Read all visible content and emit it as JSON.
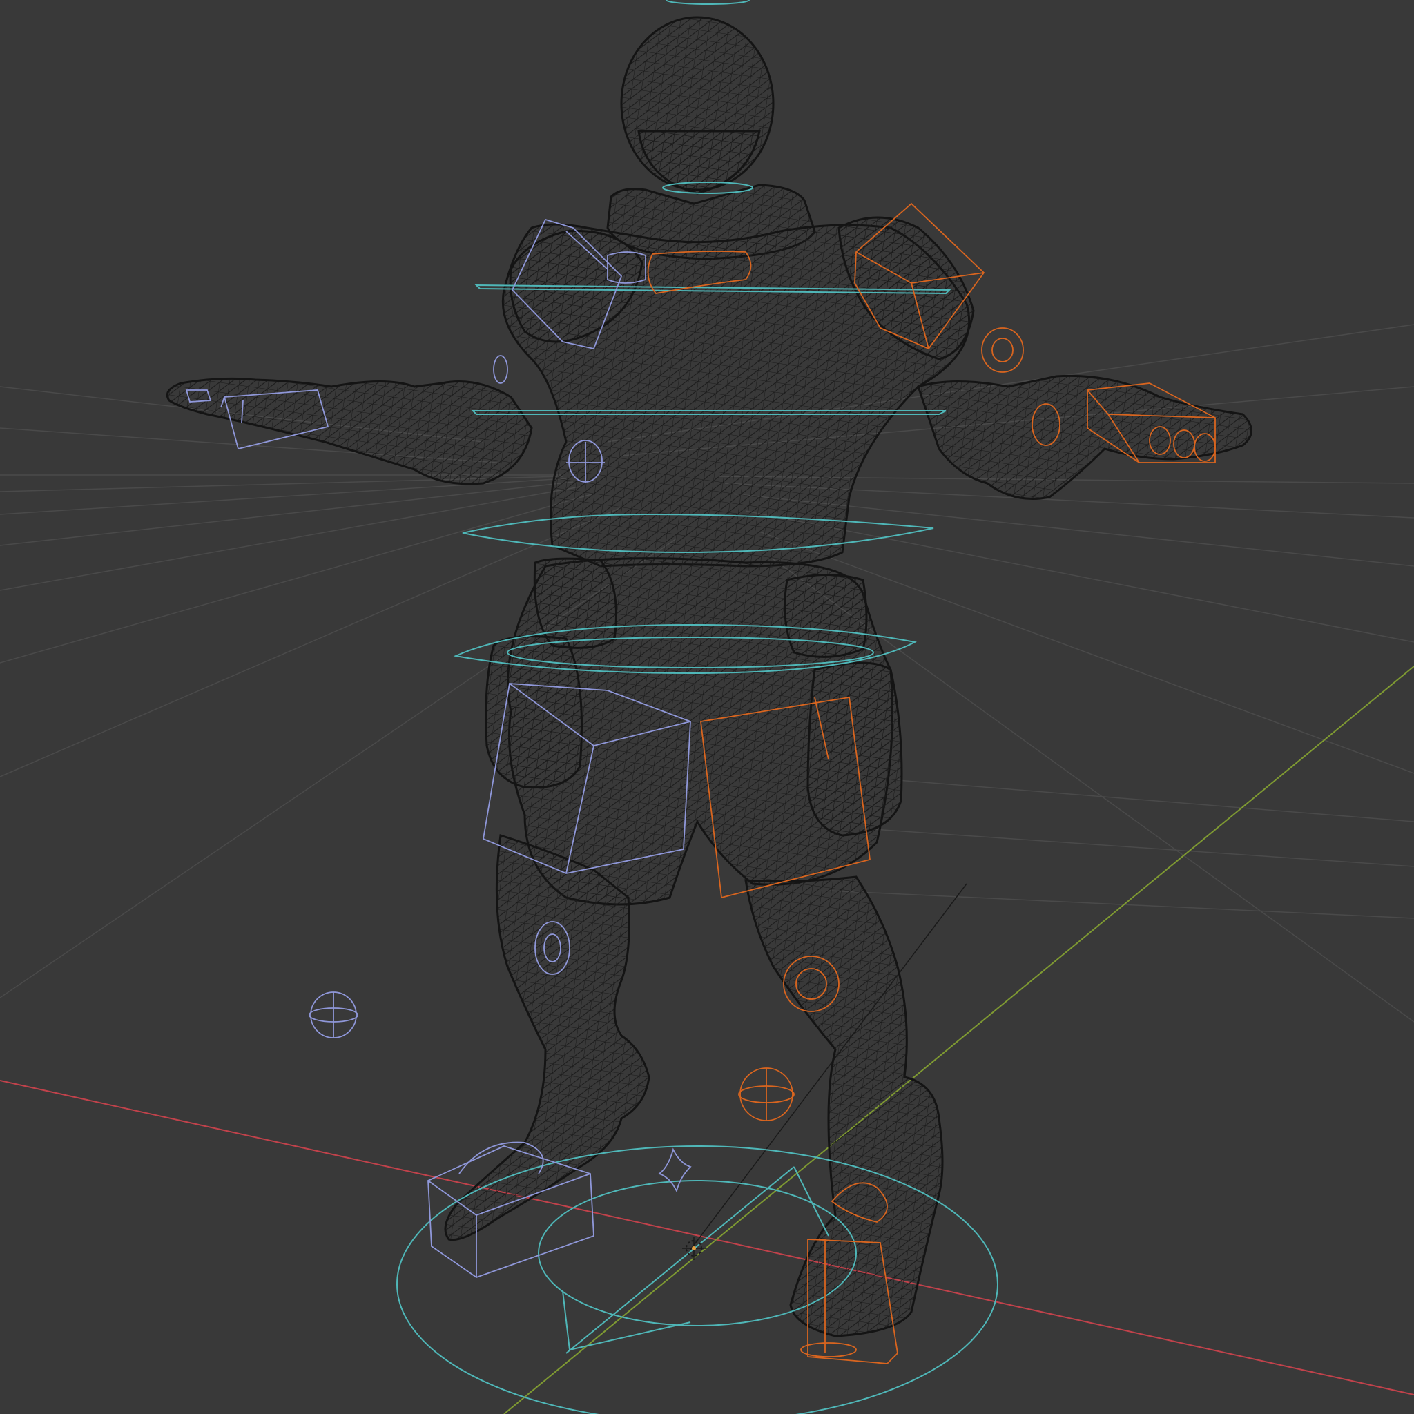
{
  "app": "3d-viewport",
  "viewport": {
    "shading": "wireframe",
    "background_color": "#393939",
    "grid_color": "#4a4a4a",
    "axis_x_color": "#c1424b",
    "axis_y_color": "#7f9a32",
    "mesh_wire_color": "#141414",
    "rig_controls": {
      "center_color": "#4fb7b8",
      "left_color": "#8f97d9",
      "right_color": "#d9651f"
    },
    "objects": {
      "mesh": "armored-character-mesh",
      "rig": "character-rig"
    }
  }
}
